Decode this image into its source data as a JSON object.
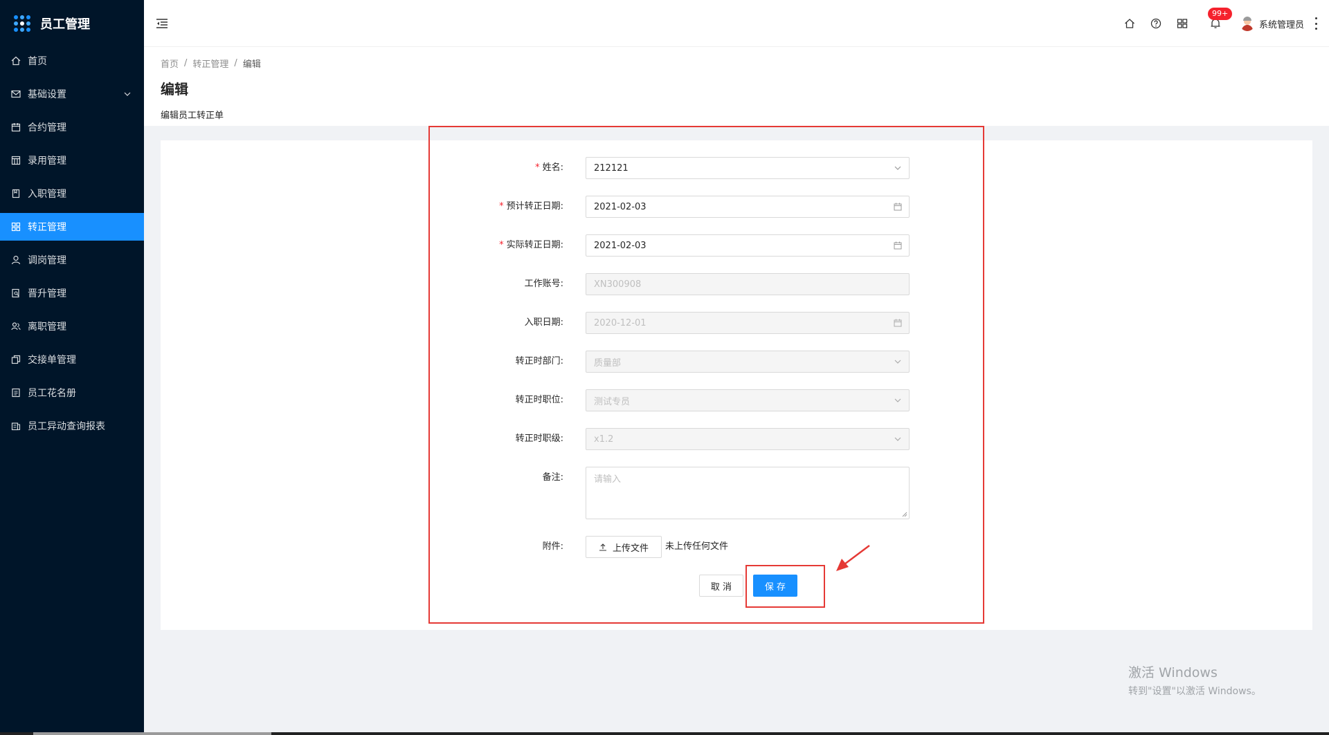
{
  "app": {
    "title": "员工管理"
  },
  "sidebar": {
    "items": [
      {
        "label": "首页",
        "icon": "home-icon"
      },
      {
        "label": "基础设置",
        "icon": "mail-icon",
        "has_submenu": true
      },
      {
        "label": "合约管理",
        "icon": "calendar-icon"
      },
      {
        "label": "录用管理",
        "icon": "layout-icon"
      },
      {
        "label": "入职管理",
        "icon": "book-icon"
      },
      {
        "label": "转正管理",
        "icon": "appstore-icon",
        "active": true
      },
      {
        "label": "调岗管理",
        "icon": "user-icon"
      },
      {
        "label": "晋升管理",
        "icon": "file-search-icon"
      },
      {
        "label": "离职管理",
        "icon": "team-icon"
      },
      {
        "label": "交接单管理",
        "icon": "copy-icon"
      },
      {
        "label": "员工花名册",
        "icon": "profile-icon"
      },
      {
        "label": "员工异动查询报表",
        "icon": "report-icon"
      }
    ]
  },
  "header": {
    "notification_badge": "99+",
    "username": "系统管理员"
  },
  "page": {
    "breadcrumb": [
      "首页",
      "转正管理",
      "编辑"
    ],
    "title": "编辑",
    "description": "编辑员工转正单"
  },
  "form": {
    "name": {
      "label": "姓名:",
      "value": "212121",
      "required": true
    },
    "expected_date": {
      "label": "预计转正日期:",
      "value": "2021-02-03",
      "required": true
    },
    "actual_date": {
      "label": "实际转正日期:",
      "value": "2021-02-03",
      "required": true
    },
    "work_account": {
      "label": "工作账号:",
      "value": "XN300908",
      "disabled": true
    },
    "hire_date": {
      "label": "入职日期:",
      "value": "2020-12-01",
      "disabled": true
    },
    "department": {
      "label": "转正时部门:",
      "value": "质量部",
      "disabled": true
    },
    "position": {
      "label": "转正时职位:",
      "value": "测试专员",
      "disabled": true
    },
    "level": {
      "label": "转正时职级:",
      "value": "x1.2",
      "disabled": true
    },
    "remark": {
      "label": "备注:",
      "placeholder": "请输入"
    },
    "attachment": {
      "label": "附件:",
      "button": "上传文件",
      "hint": "未上传任何文件"
    },
    "cancel_label": "取 消",
    "save_label": "保 存"
  },
  "watermark": {
    "title": "激活 Windows",
    "subtitle": "转到\"设置\"以激活 Windows。"
  },
  "colors": {
    "sidebar_bg": "#001529",
    "primary": "#1890ff",
    "annotation": "#e53935"
  }
}
